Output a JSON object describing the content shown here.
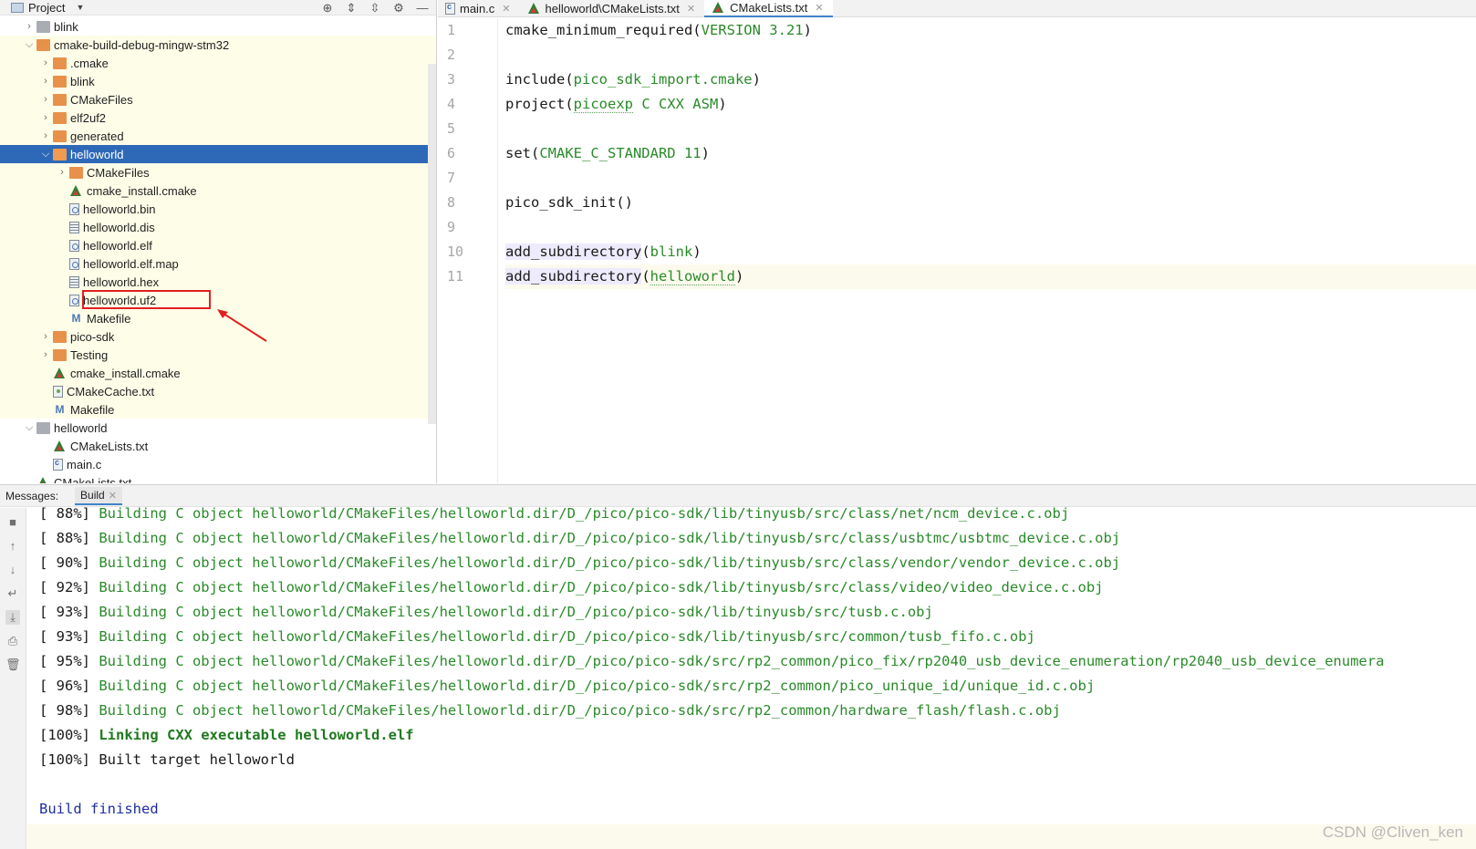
{
  "project_panel": {
    "title": "Project",
    "tree": [
      {
        "label": "blink",
        "indent": 1,
        "chevron": "closed",
        "icon": "folder-grey",
        "hl": false
      },
      {
        "label": "cmake-build-debug-mingw-stm32",
        "indent": 1,
        "chevron": "open",
        "icon": "folder-orange",
        "hl": true
      },
      {
        "label": ".cmake",
        "indent": 2,
        "chevron": "closed",
        "icon": "folder-orange",
        "hl": true
      },
      {
        "label": "blink",
        "indent": 2,
        "chevron": "closed",
        "icon": "folder-orange",
        "hl": true
      },
      {
        "label": "CMakeFiles",
        "indent": 2,
        "chevron": "closed",
        "icon": "folder-orange",
        "hl": true
      },
      {
        "label": "elf2uf2",
        "indent": 2,
        "chevron": "closed",
        "icon": "folder-orange",
        "hl": true
      },
      {
        "label": "generated",
        "indent": 2,
        "chevron": "closed",
        "icon": "folder-orange",
        "hl": true
      },
      {
        "label": "helloworld",
        "indent": 2,
        "chevron": "open",
        "icon": "folder-orange",
        "hl": true,
        "selected": true
      },
      {
        "label": "CMakeFiles",
        "indent": 3,
        "chevron": "closed",
        "icon": "folder-orange",
        "hl": true
      },
      {
        "label": "cmake_install.cmake",
        "indent": 3,
        "chevron": "none",
        "icon": "cmake",
        "hl": true
      },
      {
        "label": "helloworld.bin",
        "indent": 3,
        "chevron": "none",
        "icon": "bin",
        "hl": true
      },
      {
        "label": "helloworld.dis",
        "indent": 3,
        "chevron": "none",
        "icon": "text",
        "hl": true
      },
      {
        "label": "helloworld.elf",
        "indent": 3,
        "chevron": "none",
        "icon": "bin",
        "hl": true
      },
      {
        "label": "helloworld.elf.map",
        "indent": 3,
        "chevron": "none",
        "icon": "bin",
        "hl": true
      },
      {
        "label": "helloworld.hex",
        "indent": 3,
        "chevron": "none",
        "icon": "text",
        "hl": true
      },
      {
        "label": "helloworld.uf2",
        "indent": 3,
        "chevron": "none",
        "icon": "bin",
        "hl": true
      },
      {
        "label": "Makefile",
        "indent": 3,
        "chevron": "none",
        "icon": "make",
        "hl": true
      },
      {
        "label": "pico-sdk",
        "indent": 2,
        "chevron": "closed",
        "icon": "folder-orange",
        "hl": true
      },
      {
        "label": "Testing",
        "indent": 2,
        "chevron": "closed",
        "icon": "folder-orange",
        "hl": true
      },
      {
        "label": "cmake_install.cmake",
        "indent": 2,
        "chevron": "none",
        "icon": "cmake",
        "hl": true
      },
      {
        "label": "CMakeCache.txt",
        "indent": 2,
        "chevron": "none",
        "icon": "cache",
        "hl": true
      },
      {
        "label": "Makefile",
        "indent": 2,
        "chevron": "none",
        "icon": "make",
        "hl": true
      },
      {
        "label": "helloworld",
        "indent": 1,
        "chevron": "open",
        "icon": "folder-grey",
        "hl": false
      },
      {
        "label": "CMakeLists.txt",
        "indent": 2,
        "chevron": "none",
        "icon": "cmake",
        "hl": false
      },
      {
        "label": "main.c",
        "indent": 2,
        "chevron": "none",
        "icon": "cfile",
        "hl": false
      },
      {
        "label": "CMakeLists.txt",
        "indent": 1,
        "chevron": "none",
        "icon": "cmake",
        "hl": false
      }
    ]
  },
  "editor": {
    "tabs": [
      {
        "label": "main.c",
        "icon": "cfile",
        "active": false
      },
      {
        "label": "helloworld\\CMakeLists.txt",
        "icon": "cmake",
        "active": false
      },
      {
        "label": "CMakeLists.txt",
        "icon": "cmake",
        "active": true
      }
    ],
    "line_numbers": [
      "1",
      "2",
      "3",
      "4",
      "5",
      "6",
      "7",
      "8",
      "9",
      "10",
      "11"
    ],
    "lines": [
      [
        {
          "t": "cmake_minimum_required("
        },
        {
          "t": "VERSION 3.21",
          "c": "g"
        },
        {
          "t": ")"
        }
      ],
      [],
      [
        {
          "t": "include("
        },
        {
          "t": "pico_sdk_import.cmake",
          "c": "g"
        },
        {
          "t": ")"
        }
      ],
      [
        {
          "t": "project("
        },
        {
          "t": "picoexp",
          "c": "g u"
        },
        {
          "t": " C CXX ASM",
          "c": "g"
        },
        {
          "t": ")"
        }
      ],
      [],
      [
        {
          "t": "set("
        },
        {
          "t": "CMAKE_C_STANDARD 11",
          "c": "g"
        },
        {
          "t": ")"
        }
      ],
      [],
      [
        {
          "t": "pico_sdk_init()"
        }
      ],
      [],
      [
        {
          "t": "add_subdirectory",
          "c": "fn-hl"
        },
        {
          "t": "("
        },
        {
          "t": "blink",
          "c": "g"
        },
        {
          "t": ")"
        }
      ],
      [
        {
          "t": "add_subdirectory",
          "c": "fn-hl"
        },
        {
          "t": "("
        },
        {
          "t": "helloworld",
          "c": "g u"
        },
        {
          "t": ")"
        }
      ]
    ],
    "current_line": 11
  },
  "messages": {
    "label": "Messages:",
    "build_tab": "Build",
    "output": [
      {
        "pct": "[ 88%] ",
        "text": "Building C object helloworld/CMakeFiles/helloworld.dir/D_/pico/pico-sdk/lib/tinyusb/src/class/net/ncm_device.c.obj",
        "style": "g"
      },
      {
        "pct": "[ 88%] ",
        "text": "Building C object helloworld/CMakeFiles/helloworld.dir/D_/pico/pico-sdk/lib/tinyusb/src/class/usbtmc/usbtmc_device.c.obj",
        "style": "g"
      },
      {
        "pct": "[ 90%] ",
        "text": "Building C object helloworld/CMakeFiles/helloworld.dir/D_/pico/pico-sdk/lib/tinyusb/src/class/vendor/vendor_device.c.obj",
        "style": "g"
      },
      {
        "pct": "[ 92%] ",
        "text": "Building C object helloworld/CMakeFiles/helloworld.dir/D_/pico/pico-sdk/lib/tinyusb/src/class/video/video_device.c.obj",
        "style": "g"
      },
      {
        "pct": "[ 93%] ",
        "text": "Building C object helloworld/CMakeFiles/helloworld.dir/D_/pico/pico-sdk/lib/tinyusb/src/tusb.c.obj",
        "style": "g"
      },
      {
        "pct": "[ 93%] ",
        "text": "Building C object helloworld/CMakeFiles/helloworld.dir/D_/pico/pico-sdk/lib/tinyusb/src/common/tusb_fifo.c.obj",
        "style": "g"
      },
      {
        "pct": "[ 95%] ",
        "text": "Building C object helloworld/CMakeFiles/helloworld.dir/D_/pico/pico-sdk/src/rp2_common/pico_fix/rp2040_usb_device_enumeration/rp2040_usb_device_enumera",
        "style": "g"
      },
      {
        "pct": "[ 96%] ",
        "text": "Building C object helloworld/CMakeFiles/helloworld.dir/D_/pico/pico-sdk/src/rp2_common/pico_unique_id/unique_id.c.obj",
        "style": "g"
      },
      {
        "pct": "[ 98%] ",
        "text": "Building C object helloworld/CMakeFiles/helloworld.dir/D_/pico/pico-sdk/src/rp2_common/hardware_flash/flash.c.obj",
        "style": "g"
      },
      {
        "pct": "[100%] ",
        "text": "Linking CXX executable helloworld.elf",
        "style": "gb"
      },
      {
        "pct": "[100%] ",
        "text": "Built target helloworld",
        "style": ""
      },
      {
        "pct": "",
        "text": "",
        "style": ""
      },
      {
        "pct": "",
        "text": "Build finished",
        "style": "blue"
      }
    ]
  },
  "watermark": "CSDN @Cliven_ken",
  "colors": {
    "selection": "#2e69b8",
    "excluded_highlight": "#fefde8",
    "string_green": "#2a8a2a",
    "annotation_red": "#e02020",
    "build_finished_blue": "#1d2fa0"
  }
}
